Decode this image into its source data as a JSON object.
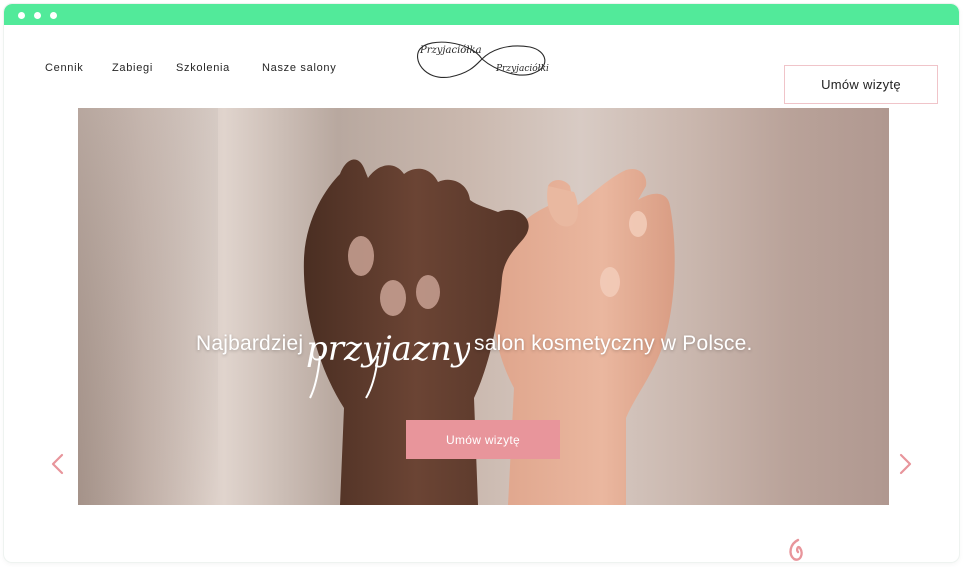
{
  "window": {
    "titlebar_color": "#52ea9a"
  },
  "nav": {
    "links": [
      {
        "label": "Cennik"
      },
      {
        "label": "Zabiegi"
      },
      {
        "label": "Szkolenia"
      },
      {
        "label": "Nasze salony"
      }
    ],
    "logo": {
      "line1": "Przyjaciółka",
      "line2": "Przyjaciółki"
    },
    "cta_label": "Umów wizytę"
  },
  "hero": {
    "headline_pre": "Najbardziej",
    "headline_script": "przyjazny",
    "headline_post": "salon kosmetyczny w Polsce.",
    "button_label": "Umów wizytę",
    "prev_icon": "chevron-left-icon",
    "next_icon": "chevron-right-icon"
  },
  "colors": {
    "accent_pink": "#e8959b",
    "cta_border": "#f0c4c9"
  }
}
